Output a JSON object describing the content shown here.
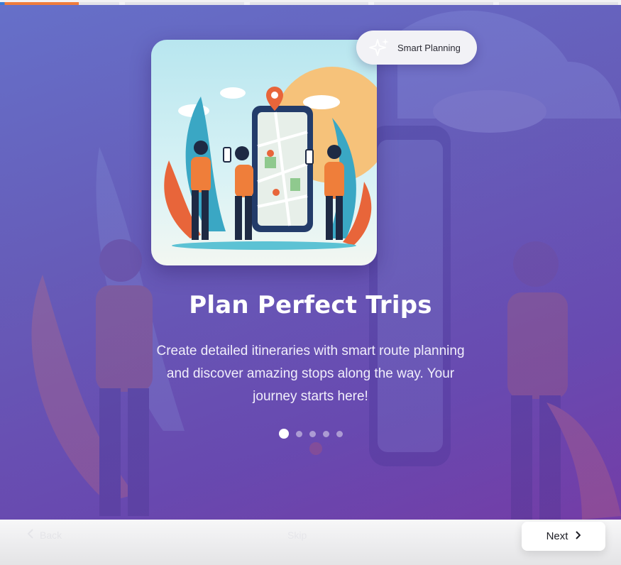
{
  "progress": {
    "segments": 5,
    "current_fill": 0.66
  },
  "badge": {
    "label": "Smart Planning",
    "icon": "sparkles-icon"
  },
  "slide": {
    "title": "Plan Perfect Trips",
    "description": "Create detailed itineraries with smart route planning and discover amazing stops along the way. Your journey starts here!"
  },
  "pagination": {
    "total": 5,
    "active_index": 0
  },
  "nav": {
    "back_label": "Back",
    "skip_label": "Skip",
    "next_label": "Next"
  },
  "colors": {
    "accent_orange": "#ee7c3d",
    "hero_start": "#6a74c9",
    "hero_end": "#7a3da6"
  }
}
